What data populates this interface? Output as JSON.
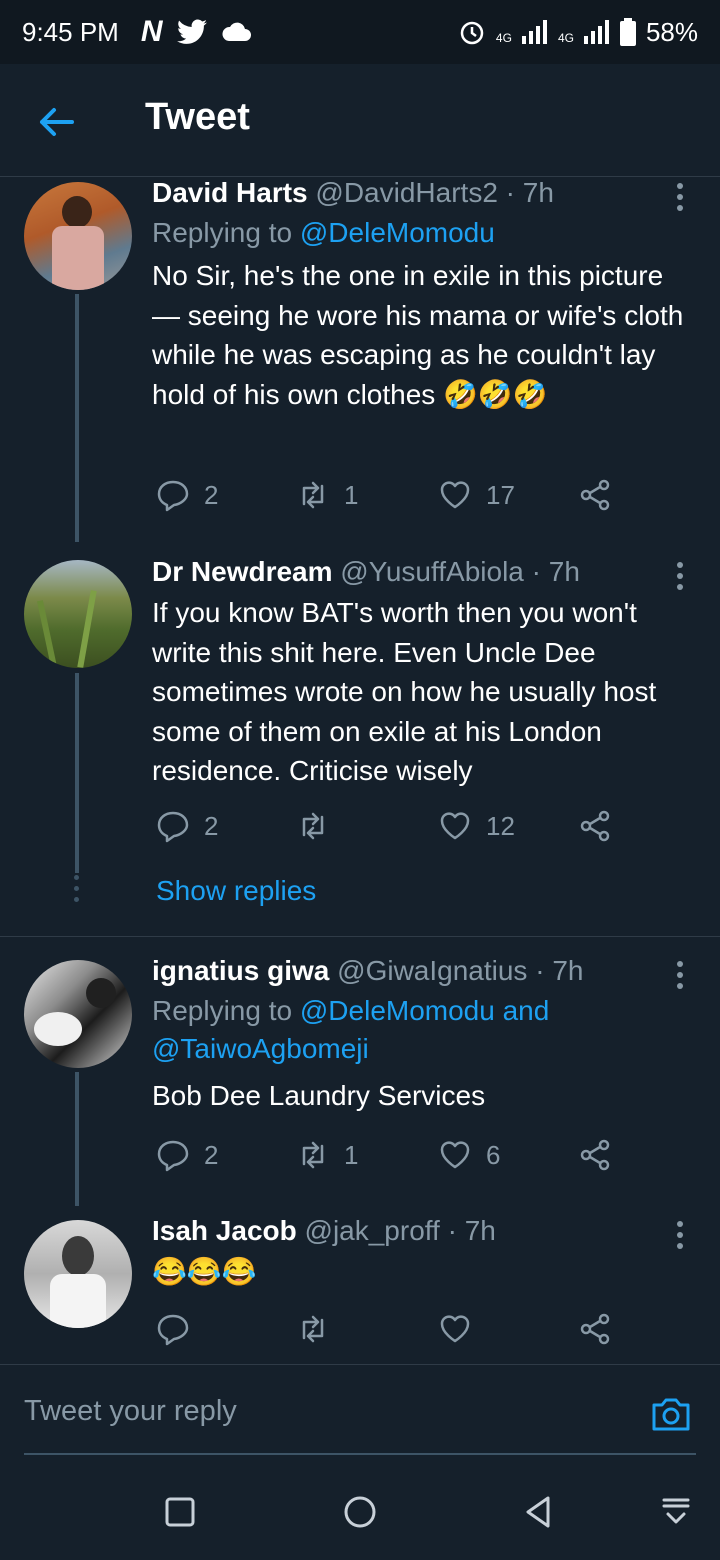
{
  "status_bar": {
    "time": "9:45 PM",
    "network_4g_1": "4G",
    "network_4g_2": "4G",
    "battery": "58%"
  },
  "header": {
    "title": "Tweet"
  },
  "tweets": [
    {
      "name": "David Harts",
      "handle": "@DavidHarts2",
      "dot": "·",
      "time": "7h",
      "replying_prefix": "Replying to",
      "replying_to": "@DeleMomodu",
      "text": "No Sir, he's the one in exile in this picture — seeing he wore his mama or wife's cloth while he was escaping as he couldn't lay hold of his own clothes 🤣🤣🤣",
      "replies": "2",
      "retweets": "1",
      "likes": "17"
    },
    {
      "name": "Dr Newdream",
      "handle": "@YusuffAbiola",
      "dot": "·",
      "time": "7h",
      "text": "If you know BAT's worth then you won't write this shit here. Even Uncle Dee sometimes wrote on how he usually host some of them on exile at his London residence. Criticise wisely",
      "replies": "2",
      "retweets": "",
      "likes": "12",
      "show_replies": "Show replies"
    },
    {
      "name": "ignatius giwa",
      "handle": "@GiwaIgnatius",
      "dot": "·",
      "time": "7h",
      "replying_prefix": "Replying to",
      "replying_to": "@DeleMomodu and @TaiwoAgbomeji",
      "text": "Bob Dee Laundry Services",
      "replies": "2",
      "retweets": "1",
      "likes": "6"
    },
    {
      "name": "Isah Jacob",
      "handle": "@jak_proff",
      "dot": "·",
      "time": "7h",
      "text": "😂😂😂",
      "replies": "",
      "retweets": "",
      "likes": ""
    }
  ],
  "reply_box": {
    "placeholder": "Tweet your reply"
  },
  "colors": {
    "background": "#15202b",
    "accent": "#1da1f2",
    "muted": "#8899a6"
  }
}
